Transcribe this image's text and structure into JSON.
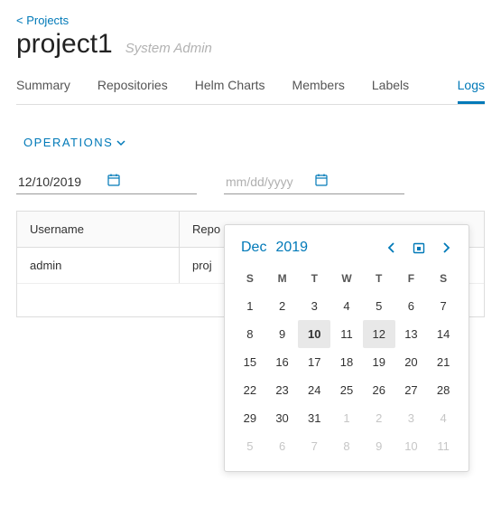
{
  "back_link": "< Projects",
  "title": "project1",
  "subtitle": "System Admin",
  "tabs": [
    {
      "label": "Summary",
      "active": false
    },
    {
      "label": "Repositories",
      "active": false
    },
    {
      "label": "Helm Charts",
      "active": false
    },
    {
      "label": "Members",
      "active": false
    },
    {
      "label": "Labels",
      "active": false
    },
    {
      "label": "Logs",
      "active": true
    }
  ],
  "operations_label": "OPERATIONS",
  "date_from": {
    "value": "12/10/2019"
  },
  "date_to": {
    "value": "",
    "placeholder": "mm/dd/yyyy"
  },
  "table": {
    "headers": {
      "username": "Username",
      "repo": "Repo"
    },
    "rows": [
      {
        "username": "admin",
        "repo": "proj"
      }
    ]
  },
  "picker": {
    "month": "Dec",
    "year": "2019",
    "dow": [
      "S",
      "M",
      "T",
      "W",
      "T",
      "F",
      "S"
    ],
    "weeks": [
      [
        {
          "n": 1
        },
        {
          "n": 2
        },
        {
          "n": 3
        },
        {
          "n": 4
        },
        {
          "n": 5
        },
        {
          "n": 6
        },
        {
          "n": 7
        }
      ],
      [
        {
          "n": 8
        },
        {
          "n": 9
        },
        {
          "n": 10,
          "sel": true
        },
        {
          "n": 11
        },
        {
          "n": 12,
          "hov": true
        },
        {
          "n": 13
        },
        {
          "n": 14
        }
      ],
      [
        {
          "n": 15
        },
        {
          "n": 16
        },
        {
          "n": 17
        },
        {
          "n": 18
        },
        {
          "n": 19
        },
        {
          "n": 20
        },
        {
          "n": 21
        }
      ],
      [
        {
          "n": 22
        },
        {
          "n": 23
        },
        {
          "n": 24
        },
        {
          "n": 25
        },
        {
          "n": 26
        },
        {
          "n": 27
        },
        {
          "n": 28
        }
      ],
      [
        {
          "n": 29
        },
        {
          "n": 30
        },
        {
          "n": 31
        },
        {
          "n": 1,
          "muted": true
        },
        {
          "n": 2,
          "muted": true
        },
        {
          "n": 3,
          "muted": true
        },
        {
          "n": 4,
          "muted": true
        }
      ],
      [
        {
          "n": 5,
          "muted": true
        },
        {
          "n": 6,
          "muted": true
        },
        {
          "n": 7,
          "muted": true
        },
        {
          "n": 8,
          "muted": true
        },
        {
          "n": 9,
          "muted": true
        },
        {
          "n": 10,
          "muted": true
        },
        {
          "n": 11,
          "muted": true
        }
      ]
    ]
  }
}
